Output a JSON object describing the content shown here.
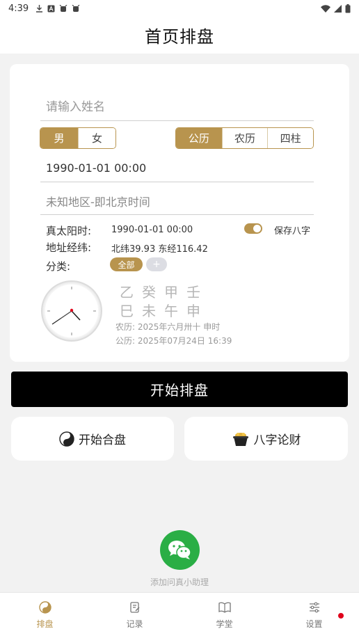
{
  "status_bar": {
    "time": "4:39"
  },
  "header": {
    "title": "首页排盘"
  },
  "form": {
    "name_placeholder": "请输入姓名",
    "gender_options": [
      "男",
      "女"
    ],
    "calendar_options": [
      "公历",
      "农历",
      "四柱"
    ],
    "datetime": "1990-01-01 00:00",
    "place": "未知地区-即北京时间"
  },
  "info": {
    "true_solar_label": "真太阳时:",
    "true_solar_value": "1990-01-01 00:00",
    "coords_label": "地址经纬:",
    "coords_value": "北纬39.93 东经116.42",
    "category_label": "分类:",
    "category_all": "全部",
    "category_add": "+",
    "save_bazi_label": "保存八字",
    "save_bazi_on": true
  },
  "bazi": {
    "stems": "乙癸甲壬",
    "branches": "巳未午申",
    "lunar": "农历: 2025年六月卅十 申时",
    "solar": "公历: 2025年07月24日 16:39"
  },
  "actions": {
    "start_label": "开始排盘",
    "hepan_label": "开始合盘",
    "lucai_label": "八字论财"
  },
  "wechat": {
    "label": "添加问真小助理"
  },
  "tabbar": {
    "items": [
      {
        "label": "排盘",
        "icon": "yinyang-icon"
      },
      {
        "label": "记录",
        "icon": "edit-note-icon"
      },
      {
        "label": "学堂",
        "icon": "book-icon"
      },
      {
        "label": "设置",
        "icon": "settings-sliders-icon"
      }
    ]
  },
  "colors": {
    "accent": "#b8944e",
    "primary_button": "#000000",
    "wechat": "#2aae45",
    "badge": "#e0001b"
  }
}
